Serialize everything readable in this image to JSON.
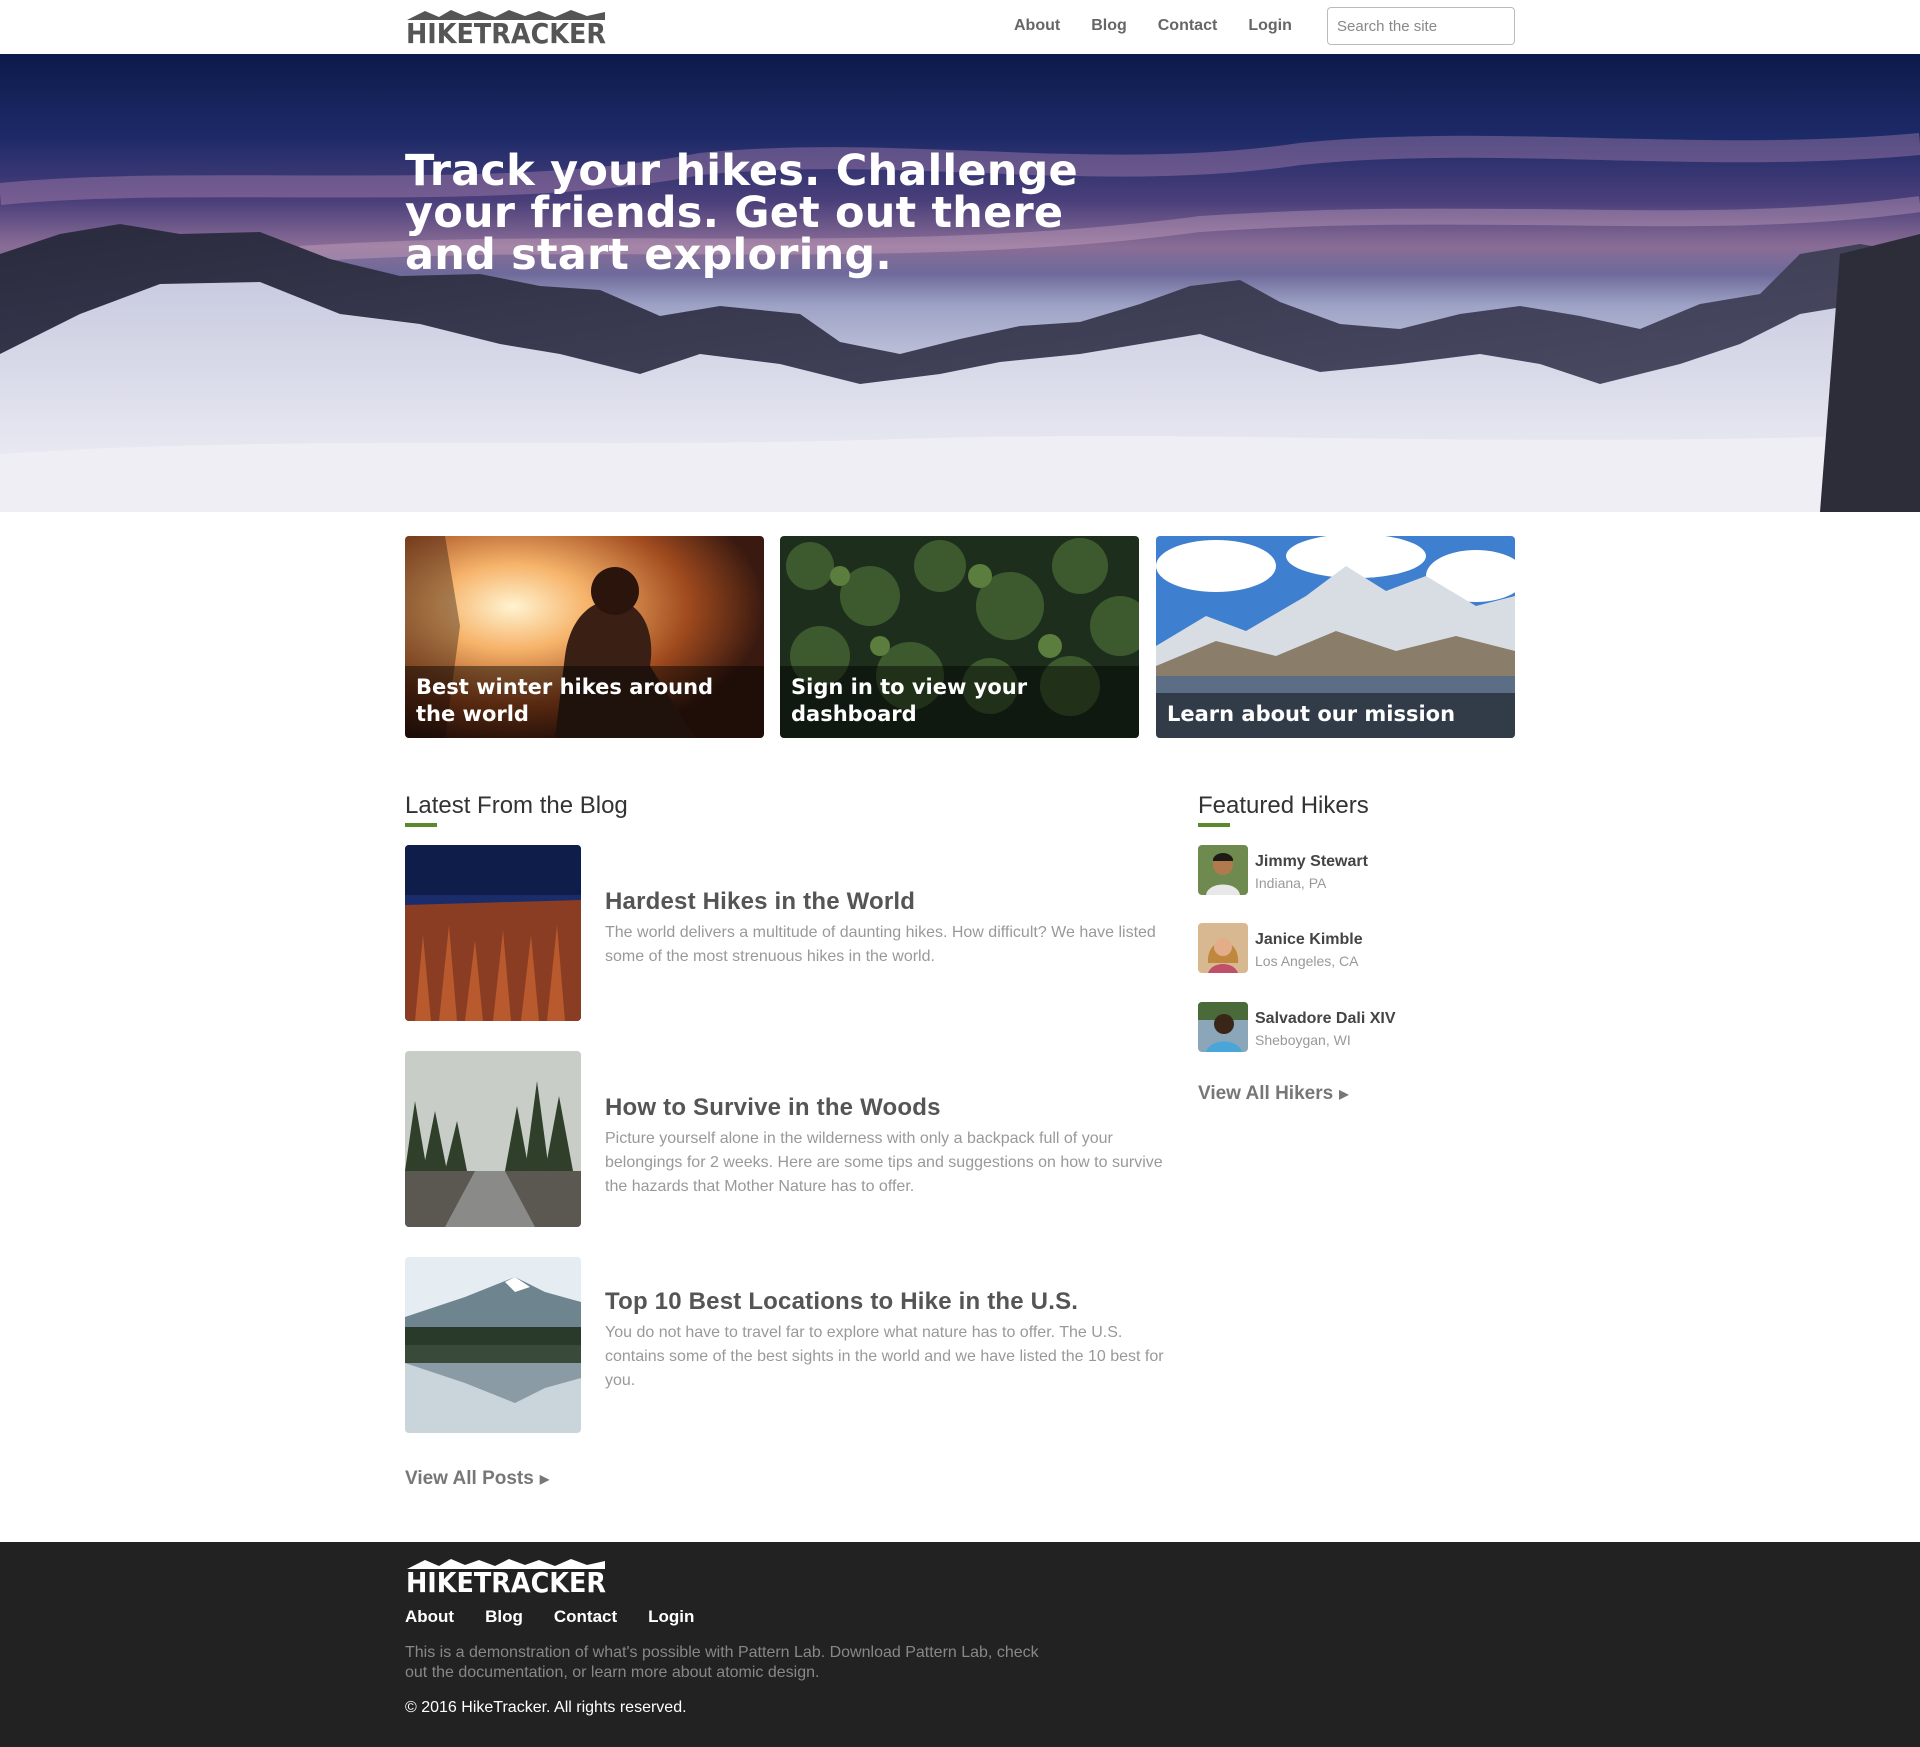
{
  "header": {
    "logo_text": "HIKETRACKER",
    "nav": [
      "About",
      "Blog",
      "Contact",
      "Login"
    ],
    "search_placeholder": "Search the site"
  },
  "hero": {
    "title": "Track your hikes. Challenge your friends. Get out there and start exploring."
  },
  "cards": [
    {
      "label": "Best winter hikes around the world"
    },
    {
      "label": "Sign in to view your dashboard"
    },
    {
      "label": "Learn about our mission"
    }
  ],
  "blog": {
    "heading": "Latest From the Blog",
    "posts": [
      {
        "title": "Hardest Hikes in the World",
        "excerpt": "The world delivers a multitude of daunting hikes. How difficult? We have listed some of the most strenuous hikes in the world."
      },
      {
        "title": "How to Survive in the Woods",
        "excerpt": "Picture yourself alone in the wilderness with only a backpack full of your belongings for 2 weeks. Here are some tips and suggestions on how to survive the hazards that Mother Nature has to offer."
      },
      {
        "title": "Top 10 Best Locations to Hike in the U.S.",
        "excerpt": "You do not have to travel far to explore what nature has to offer. The U.S. contains some of the best sights in the world and we have listed the 10 best for you."
      }
    ],
    "view_all": "View All Posts"
  },
  "hikers": {
    "heading": "Featured Hikers",
    "list": [
      {
        "name": "Jimmy Stewart",
        "location": "Indiana, PA"
      },
      {
        "name": "Janice Kimble",
        "location": "Los Angeles, CA"
      },
      {
        "name": "Salvadore Dali XIV",
        "location": "Sheboygan, WI"
      }
    ],
    "view_all": "View All Hikers"
  },
  "footer": {
    "logo_text": "HIKETRACKER",
    "nav": [
      "About",
      "Blog",
      "Contact",
      "Login"
    ],
    "description": "This is a demonstration of what's possible with Pattern Lab. Download Pattern Lab, check out the documentation, or learn more about atomic design.",
    "copyright": "© 2016 HikeTracker. All rights reserved."
  },
  "colors": {
    "accent": "#5b8a2e",
    "footer_bg": "#222222",
    "nav_text": "#666666"
  }
}
